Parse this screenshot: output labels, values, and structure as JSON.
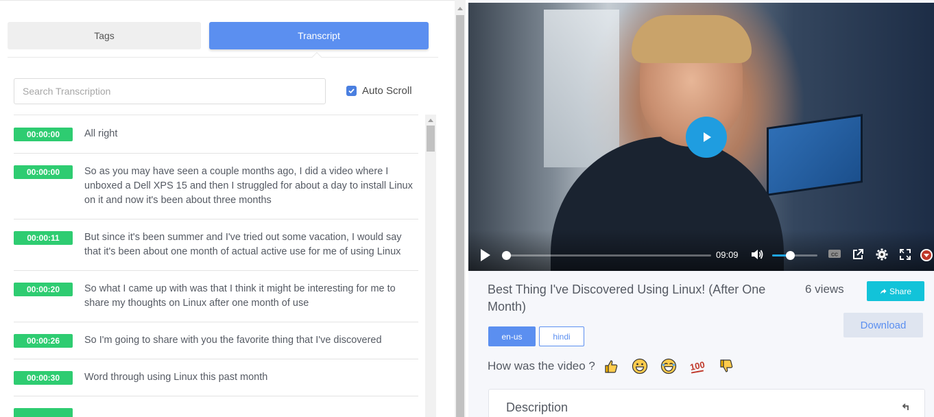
{
  "tabs": {
    "tags": "Tags",
    "transcript": "Transcript"
  },
  "search": {
    "placeholder": "Search Transcription",
    "value": ""
  },
  "autoscroll": {
    "label": "Auto Scroll",
    "checked": true
  },
  "transcript": [
    {
      "time": "00:00:00",
      "text": "All right"
    },
    {
      "time": "00:00:00",
      "text": "So as you may have seen a couple months ago, I did a video where I unboxed a Dell XPS 15 and then I struggled for about a day to install Linux on it and now it's been about three months"
    },
    {
      "time": "00:00:11",
      "text": "But since it's been summer and I've tried out some vacation, I would say that it's been about one month of actual active use for me of using Linux"
    },
    {
      "time": "00:00:20",
      "text": "So what I came up with was that I think it might be interesting for me to share my thoughts on Linux after one month of use"
    },
    {
      "time": "00:00:26",
      "text": "So I'm going to share with you the favorite thing that I've discovered"
    },
    {
      "time": "00:00:30",
      "text": "Word through using Linux this past month"
    },
    {
      "time": "",
      "text": ""
    }
  ],
  "player": {
    "duration": "09:09",
    "progress": 0,
    "volume": 0.4,
    "icons": [
      "play-icon",
      "volume-icon",
      "closed-captions-icon",
      "popout-icon",
      "settings-icon",
      "fullscreen-icon",
      "brand-icon"
    ]
  },
  "video": {
    "title": "Best Thing I've Discovered Using Linux! (After One Month)",
    "views": "6 views",
    "share_label": "Share",
    "download_label": "Download",
    "languages": [
      "en-us",
      "hindi"
    ],
    "active_language": "en-us"
  },
  "rating": {
    "question": "How was the video ?",
    "emojis": [
      "👍",
      "😀",
      "😂",
      "💯",
      "👎"
    ]
  },
  "description": {
    "title": "Description"
  },
  "colors": {
    "accent": "#5b8ff0",
    "timestamp": "#2ecc71",
    "share": "#12c3d9",
    "player_accent": "#1f9de0"
  }
}
